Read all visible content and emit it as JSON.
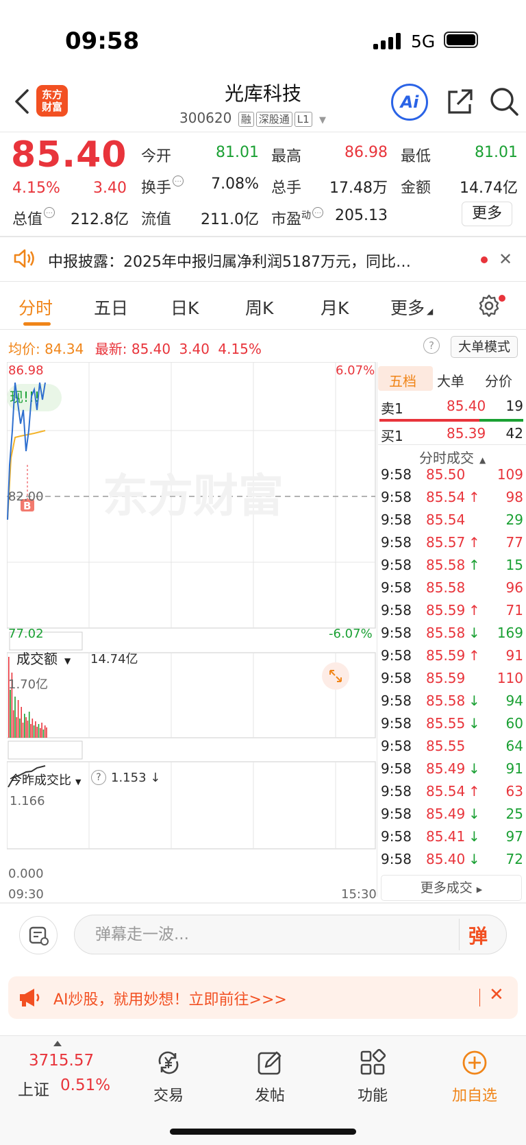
{
  "status": {
    "time": "09:58",
    "network": "5G"
  },
  "header": {
    "title": "光库科技",
    "code": "300620",
    "tags": [
      "融",
      "深股通",
      "L1"
    ],
    "logo_text": "东方财富",
    "ai_label": "Ai"
  },
  "quote": {
    "price": "85.40",
    "pct": "4.15%",
    "change": "3.40",
    "open_label": "今开",
    "open": "81.01",
    "high_label": "最高",
    "high": "86.98",
    "low_label": "最低",
    "low": "81.01",
    "turnover_label": "换手",
    "turnover": "7.08%",
    "volume_label": "总手",
    "volume": "17.48万",
    "amount_label": "金额",
    "amount": "14.74亿",
    "mcap_label": "总值",
    "mcap": "212.8亿",
    "float_label": "流值",
    "float": "211.0亿",
    "pe_label": "市盈",
    "pe_sup": "动",
    "pe": "205.13",
    "more": "更多"
  },
  "notice": {
    "text": "中报披露：2025年中报归属净利润5187万元，同比…"
  },
  "tabs": [
    "分时",
    "五日",
    "日K",
    "周K",
    "月K",
    "更多"
  ],
  "summary": {
    "avg_label": "均价:",
    "avg": "84.34",
    "last_label": "最新:",
    "last": "85.40",
    "chg": "3.40",
    "pct": "4.15%",
    "mode": "大单模式"
  },
  "chart": {
    "y_top": "86.98",
    "y_mid": "82.00",
    "y_bot": "77.02",
    "pct_top": "6.07%",
    "pct_bot": "-6.07%",
    "bubble": "现!!!",
    "marker": "B",
    "vol_selector": "成交额",
    "vol_total": "14.74亿",
    "vol_top": "1.70亿",
    "ratio_selector": "今昨成交比",
    "ratio_value": "1.153 ↓",
    "ratio_top": "1.166",
    "ratio_bot": "0.000",
    "t_start": "09:30",
    "t_end": "15:30",
    "watermark": "东方财富"
  },
  "panel": {
    "tabs": [
      "五档",
      "大单",
      "分价"
    ],
    "sell1": {
      "label": "卖1",
      "price": "85.40",
      "qty": "19"
    },
    "buy1": {
      "label": "买1",
      "price": "85.39",
      "qty": "42"
    },
    "trades_title": "分时成交",
    "trades": [
      {
        "t": "9:58",
        "p": "85.50",
        "a": "",
        "q": "109",
        "c": "red"
      },
      {
        "t": "9:58",
        "p": "85.54",
        "a": "↑",
        "q": "98",
        "c": "red"
      },
      {
        "t": "9:58",
        "p": "85.54",
        "a": "",
        "q": "29",
        "c": "green"
      },
      {
        "t": "9:58",
        "p": "85.57",
        "a": "↑",
        "q": "77",
        "c": "red"
      },
      {
        "t": "9:58",
        "p": "85.58",
        "a": "↑",
        "q": "15",
        "c": "green"
      },
      {
        "t": "9:58",
        "p": "85.58",
        "a": "",
        "q": "96",
        "c": "red"
      },
      {
        "t": "9:58",
        "p": "85.59",
        "a": "↑",
        "q": "71",
        "c": "red"
      },
      {
        "t": "9:58",
        "p": "85.58",
        "a": "↓",
        "q": "169",
        "c": "green"
      },
      {
        "t": "9:58",
        "p": "85.59",
        "a": "↑",
        "q": "91",
        "c": "red"
      },
      {
        "t": "9:58",
        "p": "85.59",
        "a": "",
        "q": "110",
        "c": "red"
      },
      {
        "t": "9:58",
        "p": "85.58",
        "a": "↓",
        "q": "94",
        "c": "green"
      },
      {
        "t": "9:58",
        "p": "85.55",
        "a": "↓",
        "q": "60",
        "c": "green"
      },
      {
        "t": "9:58",
        "p": "85.55",
        "a": "",
        "q": "64",
        "c": "green"
      },
      {
        "t": "9:58",
        "p": "85.49",
        "a": "↓",
        "q": "91",
        "c": "green"
      },
      {
        "t": "9:58",
        "p": "85.54",
        "a": "↑",
        "q": "63",
        "c": "red"
      },
      {
        "t": "9:58",
        "p": "85.49",
        "a": "↓",
        "q": "25",
        "c": "green"
      },
      {
        "t": "9:58",
        "p": "85.41",
        "a": "↓",
        "q": "97",
        "c": "green"
      },
      {
        "t": "9:58",
        "p": "85.40",
        "a": "↓",
        "q": "72",
        "c": "green"
      }
    ],
    "more_trades": "更多成交"
  },
  "danmu": {
    "placeholder": "弹幕走一波...",
    "button": "弹"
  },
  "banner": {
    "text": "AI炒股，就用妙想！立即前往>>>"
  },
  "bottom": {
    "index_value": "3715.57",
    "index_name": "上证",
    "index_pct": "0.51%",
    "items": [
      "交易",
      "发帖",
      "功能",
      "加自选"
    ]
  },
  "colors": {
    "up": "#e8343b",
    "down": "#1aa033",
    "accent": "#f08519",
    "brand": "#f25022"
  }
}
